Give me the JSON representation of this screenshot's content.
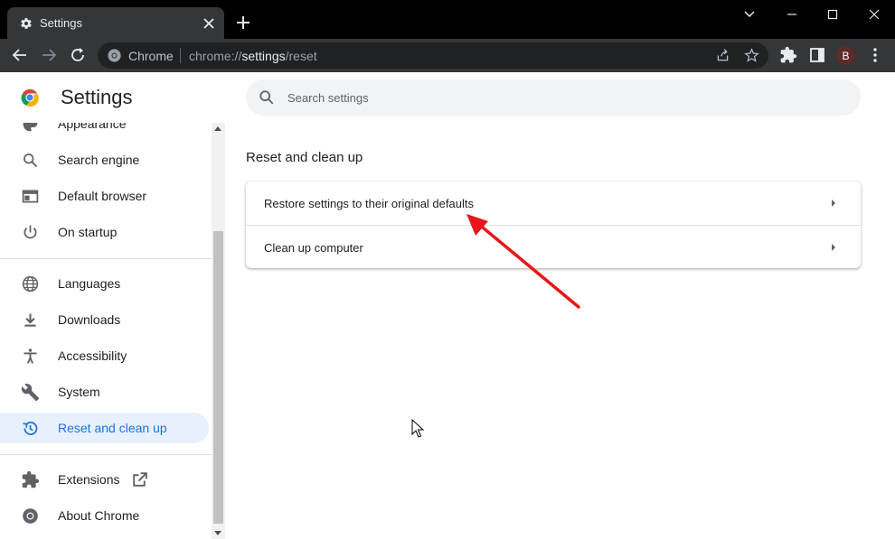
{
  "browser": {
    "tab_title": "Settings",
    "omnibox_label": "Chrome",
    "url_scheme": "chrome://",
    "url_host": "settings",
    "url_path": "/reset",
    "profile_initial": "B"
  },
  "settings": {
    "title": "Settings",
    "search_placeholder": "Search settings",
    "nav": [
      {
        "label": "Appearance",
        "icon": "palette-icon"
      },
      {
        "label": "Search engine",
        "icon": "search-icon"
      },
      {
        "label": "Default browser",
        "icon": "browser-icon"
      },
      {
        "label": "On startup",
        "icon": "power-icon"
      },
      {
        "label": "Languages",
        "icon": "globe-icon"
      },
      {
        "label": "Downloads",
        "icon": "download-icon"
      },
      {
        "label": "Accessibility",
        "icon": "accessibility-icon"
      },
      {
        "label": "System",
        "icon": "wrench-icon"
      },
      {
        "label": "Reset and clean up",
        "icon": "history-icon"
      },
      {
        "label": "Extensions",
        "icon": "puzzle-icon"
      },
      {
        "label": "About Chrome",
        "icon": "chrome-icon"
      }
    ],
    "section_title": "Reset and clean up",
    "rows": [
      {
        "label": "Restore settings to their original defaults"
      },
      {
        "label": "Clean up computer"
      }
    ]
  },
  "colors": {
    "accent": "#1a73e8",
    "active_bg": "#e8f0fe",
    "annotation_arrow": "#e8161b"
  }
}
